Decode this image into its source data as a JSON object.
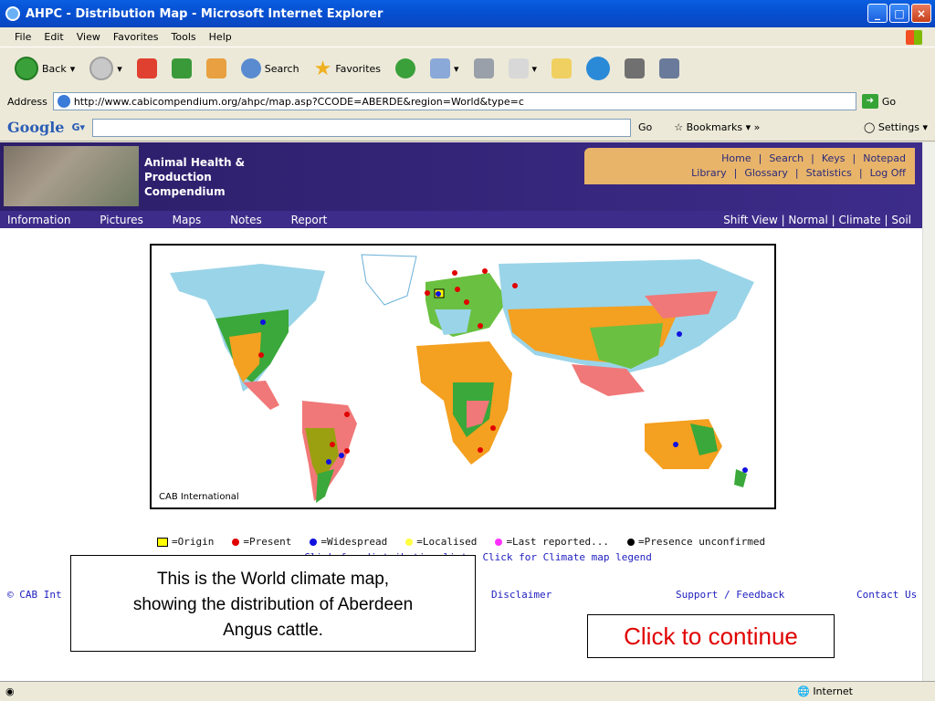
{
  "window": {
    "title": "AHPC - Distribution Map - Microsoft Internet Explorer"
  },
  "menu": [
    "File",
    "Edit",
    "View",
    "Favorites",
    "Tools",
    "Help"
  ],
  "toolbar": {
    "back": "Back",
    "search": "Search",
    "favorites": "Favorites"
  },
  "address": {
    "label": "Address",
    "url": "http://www.cabicompendium.org/ahpc/map.asp?CCODE=ABERDE&region=World&type=c",
    "go": "Go"
  },
  "google": {
    "logo": "Google",
    "go": "Go",
    "bookmarks": "Bookmarks",
    "settings": "Settings"
  },
  "site": {
    "title_line1": "Animal Health &",
    "title_line2": "Production",
    "title_line3": "Compendium",
    "nav_row1": [
      "Home",
      "|",
      "Search",
      "|",
      "Keys",
      "|",
      "Notepad"
    ],
    "nav_row2": [
      "Library",
      "|",
      "Glossary",
      "|",
      "Statistics",
      "|",
      "Log Off"
    ],
    "subnav": [
      "Information",
      "Pictures",
      "Maps",
      "Notes",
      "Report"
    ],
    "subnav_right": "Shift View | Normal | Climate | Soil"
  },
  "map": {
    "credit": "CAB International"
  },
  "legend": {
    "origin": "=Origin",
    "present": "=Present",
    "widespread": "=Widespread",
    "localised": "=Localised",
    "last": "=Last reported...",
    "unconfirmed": "=Presence unconfirmed",
    "colors": {
      "origin": "#ffff00",
      "present": "#e00000",
      "widespread": "#1010e0",
      "localised": "#ffff40",
      "last": "#ff30ff",
      "unconfirmed": "#000000"
    }
  },
  "links": {
    "dist": "Click for distribution list",
    "climate": "Click for Climate map legend"
  },
  "footer": {
    "copy": "© CAB Int",
    "disclaimer": "Disclaimer",
    "support": "Support / Feedback",
    "contact": "Contact Us"
  },
  "note": {
    "line1": "This is the World climate map,",
    "line2": "showing the distribution of Aberdeen",
    "line3": "Angus cattle."
  },
  "continue": "Click to continue",
  "status": {
    "zone": "Internet"
  }
}
